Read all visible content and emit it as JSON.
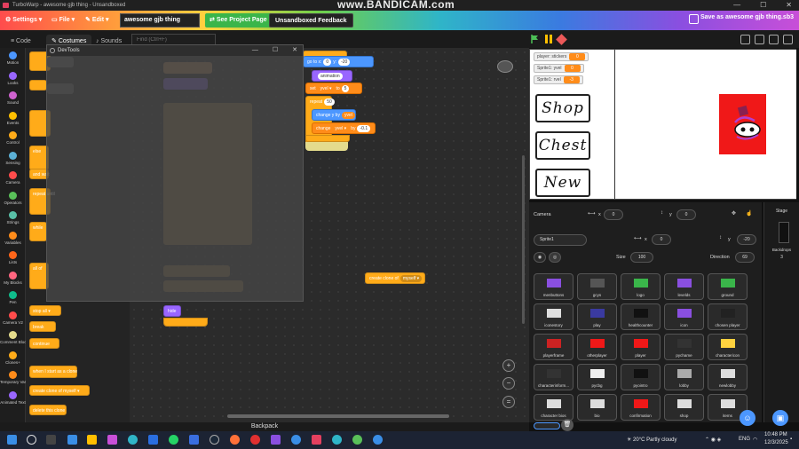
{
  "window": {
    "title": "TurboWarp - awesome gjb thing - Unsandboxed",
    "watermark": "www.BANDICAM.com"
  },
  "menu": {
    "settings": "Settings ▾",
    "file": "File ▾",
    "edit": "Edit ▾",
    "project_title": "awesome gjb thing",
    "see_project": "See Project Page",
    "unsandboxed": "Unsandboxed Feedback",
    "save_as": "Save as awesome gjb thing.sb3"
  },
  "tabs": [
    {
      "label": "Code"
    },
    {
      "label": "Costumes"
    },
    {
      "label": "Sounds"
    }
  ],
  "search": {
    "placeholder": "Find (Ctrl+F)"
  },
  "devtools": {
    "title": "DevTools"
  },
  "categories": [
    {
      "label": "Motion",
      "color": "#4c97ff"
    },
    {
      "label": "Looks",
      "color": "#9966ff"
    },
    {
      "label": "Sound",
      "color": "#cf63cf"
    },
    {
      "label": "Events",
      "color": "#ffbf00"
    },
    {
      "label": "Control",
      "color": "#ffab19"
    },
    {
      "label": "Sensing",
      "color": "#5cb1d6"
    },
    {
      "label": "Camera",
      "color": "#ff4c4c"
    },
    {
      "label": "Operators",
      "color": "#59c059"
    },
    {
      "label": "Strings",
      "color": "#59c0a8"
    },
    {
      "label": "Variables",
      "color": "#ff8c1a"
    },
    {
      "label": "Lists",
      "color": "#ff661a"
    },
    {
      "label": "My Blocks",
      "color": "#ff6680"
    },
    {
      "label": "Pen",
      "color": "#0fbd8c"
    },
    {
      "label": "Camera V2",
      "color": "#ff4c4c"
    },
    {
      "label": "Comment Blocks",
      "color": "#e4db8c"
    },
    {
      "label": "Clones+",
      "color": "#ffab19"
    },
    {
      "label": "Temporary Variables",
      "color": "#ff8c1a"
    },
    {
      "label": "Animated Text",
      "color": "#9966ff"
    }
  ],
  "palette": {
    "stop_all": "stop  all ▾",
    "break": "break",
    "continue": "continue",
    "when_clone": "when I start as a clone",
    "create_clone": "create clone of  myself ▾",
    "delete_clone": "delete this clone",
    "else": "else",
    "and_wait": "and wait",
    "repeat_until": "repeat until",
    "while": "while",
    "all_of": "all of"
  },
  "script": {
    "goto": "go to x:",
    "goto_x": "0",
    "goto_y_label": "y:",
    "goto_y": "-20",
    "switch": "animation",
    "set": "set",
    "set_var": "yvel ▾",
    "set_to": "to",
    "set_val": "5",
    "repeat": "repeat",
    "repeat_val": "50",
    "change_y": "change y by",
    "change_y_val": "yvel",
    "change": "change",
    "change_var": "yvel ▾",
    "change_by": "by",
    "change_val": "-0.1",
    "create_clone": "create clone of",
    "create_clone_val": "myself ▾",
    "hide": "hide"
  },
  "stage": {
    "monitors": [
      {
        "label": "player: stickers",
        "value": "0"
      },
      {
        "label": "Sprite1: yvel",
        "value": "0"
      },
      {
        "label": "Sprite1: rvel",
        "value": "-3"
      }
    ],
    "buttons": [
      "Shop",
      "Chest",
      "New"
    ]
  },
  "camera": {
    "label": "Camera",
    "x": "0",
    "y": "0"
  },
  "sprite_info": {
    "name": "Sprite1",
    "x_label": "x",
    "x": "0",
    "y_label": "y",
    "y": "-20",
    "size_label": "Size",
    "size": "100",
    "direction_label": "Direction",
    "direction": "69"
  },
  "stage_pane": {
    "label": "Stage",
    "backdrops_label": "Backdrops",
    "backdrops": "3"
  },
  "sprites": [
    {
      "name": "menbuttons",
      "color": "#8a4fe0"
    },
    {
      "name": "gcys",
      "color": "#555555"
    },
    {
      "name": "logo",
      "color": "#3ab54a"
    },
    {
      "name": "levelds",
      "color": "#8a4fe0"
    },
    {
      "name": "ground",
      "color": "#3ab54a"
    },
    {
      "name": "iconestory",
      "color": "#dddddd"
    },
    {
      "name": "play",
      "color": "#3a3aa0"
    },
    {
      "name": "healthcounter",
      "color": "#111111"
    },
    {
      "name": "icon",
      "color": "#8a4fe0"
    },
    {
      "name": "chosen player",
      "color": "#222222"
    },
    {
      "name": "playerframe",
      "color": "#cc2222"
    },
    {
      "name": "otherplayer",
      "color": "#f01818"
    },
    {
      "name": "player",
      "color": "#f01818"
    },
    {
      "name": "pychame",
      "color": "#333333"
    },
    {
      "name": "charactericon",
      "color": "#ffd23f"
    },
    {
      "name": "characterinform...",
      "color": "#333333"
    },
    {
      "name": "pycbg",
      "color": "#eeeeee"
    },
    {
      "name": "pyointro",
      "color": "#111111"
    },
    {
      "name": "lobby",
      "color": "#aaaaaa"
    },
    {
      "name": "newlobby",
      "color": "#dddddd"
    },
    {
      "name": "character bios",
      "color": "#dddddd"
    },
    {
      "name": "bio",
      "color": "#dddddd"
    },
    {
      "name": "confirmation",
      "color": "#f01818"
    },
    {
      "name": "shop",
      "color": "#dddddd"
    },
    {
      "name": "items",
      "color": "#dddddd"
    }
  ],
  "backpack": {
    "label": "Backpack"
  },
  "taskbar": {
    "weather": "20°C  Partly cloudy",
    "lang": "ENG",
    "time": "10:48 PM",
    "date": "12/3/2025"
  }
}
